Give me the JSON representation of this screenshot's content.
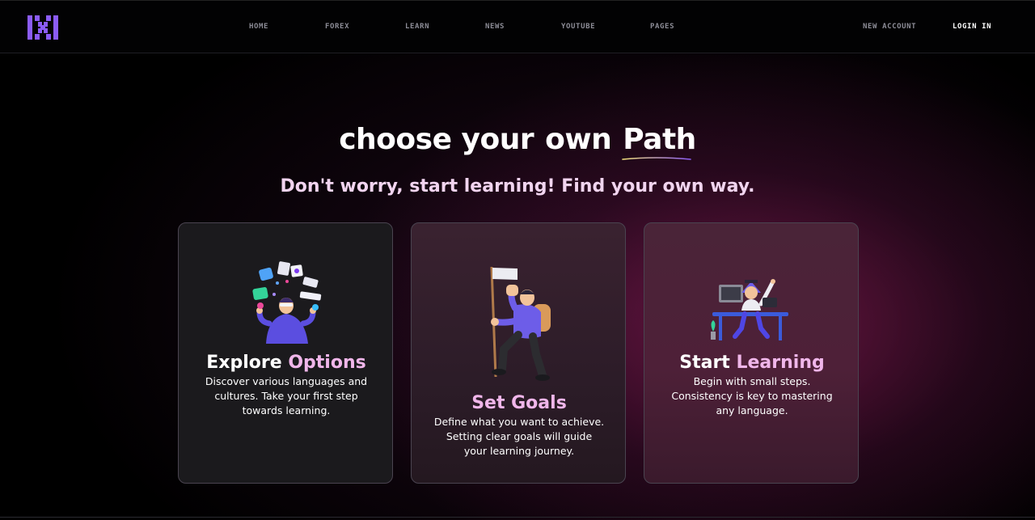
{
  "nav": {
    "logo_text": "IXI",
    "links": [
      "HOME",
      "FOREX",
      "LEARN",
      "NEWS",
      "YOUTUBE",
      "PAGES"
    ],
    "new_account": "NEW ACCOUNT",
    "login": "LOGIN IN"
  },
  "hero": {
    "title_part1": "choose your",
    "title_part2": "own",
    "title_part3": "Path",
    "subtitle": "Don't worry, start learning! Find your own way."
  },
  "cards": [
    {
      "title_a": "Explore ",
      "title_b": "Options",
      "lines": [
        "Discover various languages and",
        "cultures. Take your first step",
        "towards learning."
      ],
      "illustration": "juggling-person-icon"
    },
    {
      "title_a": "Set Goals",
      "title_b": "",
      "lines": [
        "Define what you want to achieve.",
        "Setting clear goals will guide",
        "your learning journey."
      ],
      "illustration": "flag-climber-icon"
    },
    {
      "title_a": "Start ",
      "title_b": "Learning",
      "lines": [
        "Begin with small steps.",
        "Consistency is key to mastering",
        "any language."
      ],
      "illustration": "desk-student-icon"
    }
  ],
  "colors": {
    "accent_purple": "#8b5cf6",
    "accent_pink": "#f0b6ea",
    "underline_gradient": [
      "#f3e27a",
      "#8b5cf6"
    ]
  }
}
